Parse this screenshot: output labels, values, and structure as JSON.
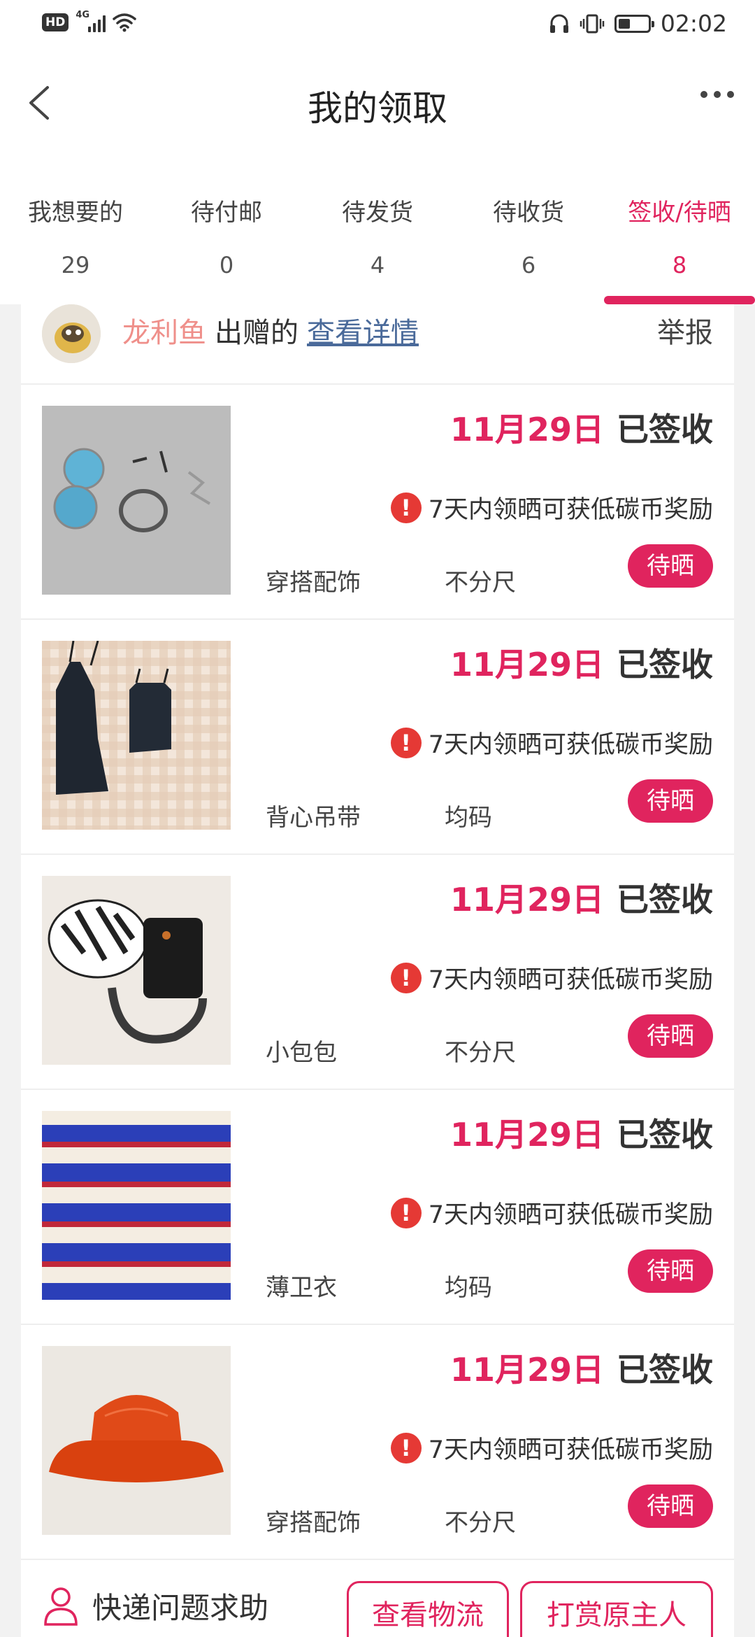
{
  "status_bar": {
    "hd": "HD",
    "network": "4G",
    "time": "02:02"
  },
  "header": {
    "title": "我的领取"
  },
  "tabs": [
    {
      "label": "我想要的",
      "count": "29"
    },
    {
      "label": "待付邮",
      "count": "0"
    },
    {
      "label": "待发货",
      "count": "4"
    },
    {
      "label": "待收货",
      "count": "6"
    },
    {
      "label": "签收/待晒",
      "count": "8",
      "active": true
    }
  ],
  "donor": {
    "name": "龙利鱼",
    "verb": "出赠的",
    "link": "查看详情",
    "report": "举报"
  },
  "items": [
    {
      "date": "11月29日",
      "status": "已签收",
      "tip": "7天内领晒可获低碳币奖励",
      "category": "穿搭配饰",
      "size": "不分尺",
      "action": "待晒"
    },
    {
      "date": "11月29日",
      "status": "已签收",
      "tip": "7天内领晒可获低碳币奖励",
      "category": "背心吊带",
      "size": "均码",
      "action": "待晒"
    },
    {
      "date": "11月29日",
      "status": "已签收",
      "tip": "7天内领晒可获低碳币奖励",
      "category": "小包包",
      "size": "不分尺",
      "action": "待晒"
    },
    {
      "date": "11月29日",
      "status": "已签收",
      "tip": "7天内领晒可获低碳币奖励",
      "category": "薄卫衣",
      "size": "均码",
      "action": "待晒"
    },
    {
      "date": "11月29日",
      "status": "已签收",
      "tip": "7天内领晒可获低碳币奖励",
      "category": "穿搭配饰",
      "size": "不分尺",
      "action": "待晒"
    }
  ],
  "bottom": {
    "help": "快递问题求助",
    "logistics": "查看物流",
    "tip_owner": "打赏原主人"
  },
  "colors": {
    "accent": "#e0245e",
    "donor_name": "#ef8f8a",
    "link": "#4a6a9a",
    "warning": "#e53935"
  }
}
